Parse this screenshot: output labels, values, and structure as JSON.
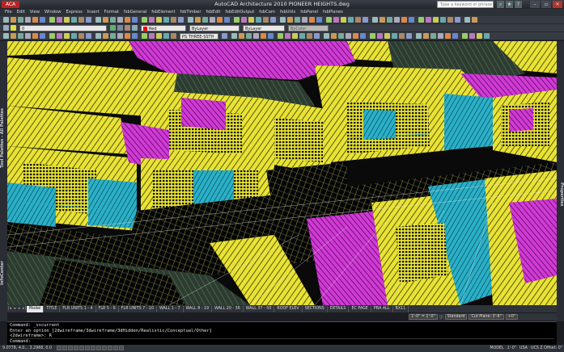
{
  "window": {
    "title": "AutoCAD Architecture 2010    PIONEER HEIGHTS.dwg",
    "app_badge": "ACA",
    "search_placeholder": "Type a keyword or phrase",
    "controls": [
      "–",
      "▫",
      "✕"
    ]
  },
  "menu": [
    "File",
    "Edit",
    "View",
    "Window",
    "Express",
    "Insert",
    "Format",
    "fsbGeneral",
    "fsbElement",
    "fsbTimber",
    "fsbEdit",
    "fsbEditOutput",
    "fsbCam",
    "fsbUtils",
    "fsbPanel",
    "fsbPlanes"
  ],
  "toolbar": {
    "layer_value": "0",
    "color_value": "Red",
    "color_swatch": "#ff0000",
    "linetype_value": "ByLayer",
    "lineweight_value": "ByLayer",
    "plotstyle_value": "ByColor",
    "view_value": "PS THREE-SSTH"
  },
  "side_panels": {
    "left_top": "Tool Palettes - All Palettes",
    "left_bottom": "InfoCenter",
    "right": "Properties"
  },
  "layout_tabs": [
    "Model",
    "TITLE",
    "FLR UNITS 1 - 4",
    "FLR 5 - 6",
    "FLR UNITS 7 - 10",
    "WALL 1 - 7",
    "WALL 8 - 19",
    "WALL 20 - 36",
    "WALL 37 - 50",
    "ROOF ELEV",
    "SECTIONS",
    "DETAILS",
    "EC PAGE",
    "PBA ALL",
    "BX11"
  ],
  "active_tab": "Model",
  "view_controls": {
    "scale": "1'-0\" = 1'-0\"",
    "detail": "Standard",
    "cut_plane": "Cut Plane: 3'-6\"",
    "level": "+0\""
  },
  "command_lines": [
    "Command: _vscurrent",
    "Enter an option [2dwireframe/3dwireframe/3dHidden/Realistic/Conceptual/Other]",
    "<2dwireframe>: R",
    "Command:"
  ],
  "status": {
    "coords": "9.0778, 4.0... 3.2968, 0.0",
    "model": "MODEL",
    "scale": "1'-0\"",
    "units": "USA",
    "ucs": "UCS Z Offset: 0\""
  }
}
